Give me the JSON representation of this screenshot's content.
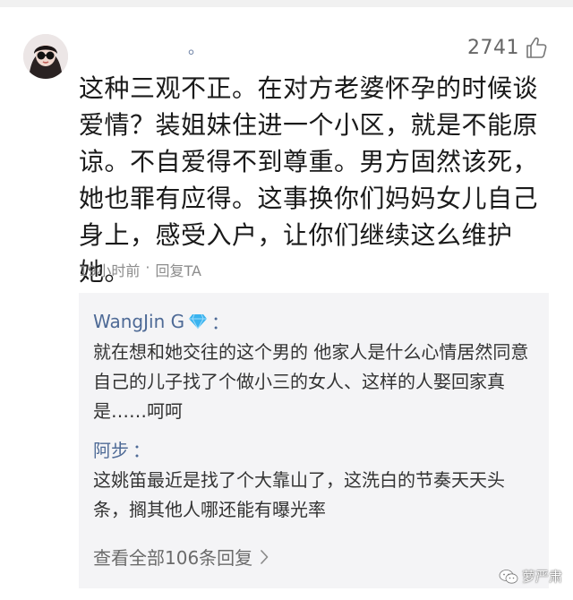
{
  "comment": {
    "username": "。",
    "likes": "2741",
    "text": "这种三观不正。在对方老婆怀孕的时候谈爱情？装姐妹住进一个小区，就是不能原谅。不自爱得不到尊重。男方固然该死，她也罪有应得。这事换你们妈妈女儿自己身上，感受入户，让你们继续这么维护她。",
    "time": "19小时前",
    "separator": "·",
    "reply_label": "回复TA"
  },
  "replies": [
    {
      "name": "WangJin G",
      "colon": "：",
      "text": "就在想和她交往的这个男的 他家人是什么心情居然同意自己的儿子找了个做小三的女人、这样的人娶回家真是……呵呵"
    },
    {
      "name": "阿步",
      "colon": "：",
      "text": "这姚笛最近是找了个大靠山了，这洗白的节奏天天头条，搁其他人哪还能有曝光率"
    }
  ],
  "view_all_label": "查看全部106条回复",
  "watermark": "萝严肃",
  "colors": {
    "name_link": "#4e6a96",
    "reply_bg": "#f4f4f6",
    "diamond": "#3ab3ef"
  },
  "icons": {
    "like": "thumbs-up-icon",
    "badge": "diamond-icon",
    "more": "chevron-right-icon"
  }
}
